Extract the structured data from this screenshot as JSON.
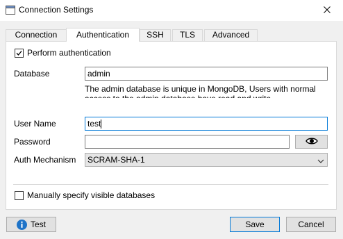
{
  "window": {
    "title": "Connection Settings",
    "close_glyph": "✕"
  },
  "tabs": [
    {
      "label": "Connection",
      "active": false
    },
    {
      "label": "Authentication",
      "active": true
    },
    {
      "label": "SSH",
      "active": false
    },
    {
      "label": "TLS",
      "active": false
    },
    {
      "label": "Advanced",
      "active": false
    }
  ],
  "auth": {
    "perform_label": "Perform authentication",
    "perform_checked": true,
    "database_label": "Database",
    "database_value": "admin",
    "database_desc": "The admin database is unique in MongoDB, Users with normal access to the admin database have read and write",
    "username_label": "User Name",
    "username_value": "test",
    "password_label": "Password",
    "password_value": "",
    "mechanism_label": "Auth Mechanism",
    "mechanism_value": "SCRAM-SHA-1",
    "manual_db_label": "Manually specify visible databases",
    "manual_db_checked": false
  },
  "buttons": {
    "test": "Test",
    "save": "Save",
    "cancel": "Cancel"
  },
  "icons": {
    "app": "window-icon",
    "close": "close-icon",
    "info": "info-icon",
    "eye": "eye-icon",
    "chevron": "chevron-down-icon",
    "check": "check-icon"
  },
  "colors": {
    "focus_border": "#0078d7",
    "info_blue": "#1e73c8"
  }
}
